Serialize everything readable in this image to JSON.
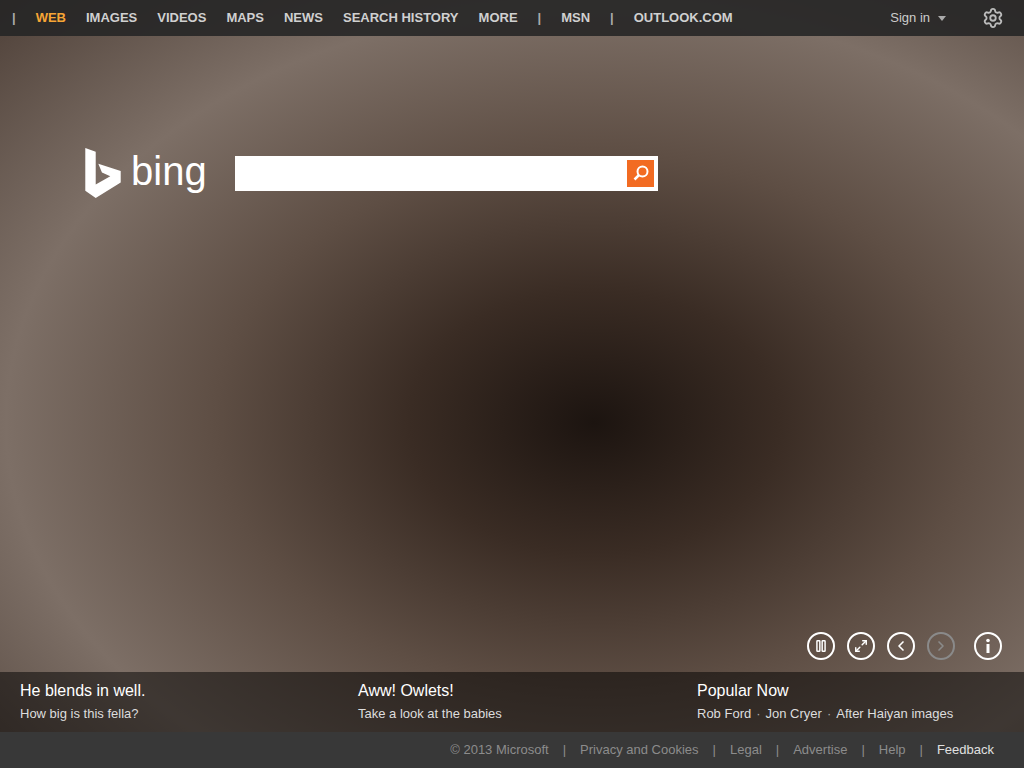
{
  "nav": {
    "items": [
      {
        "label": "|",
        "kind": "separator",
        "selected": false
      },
      {
        "label": "WEB",
        "kind": "link",
        "selected": true
      },
      {
        "label": "IMAGES",
        "kind": "link",
        "selected": false
      },
      {
        "label": "VIDEOS",
        "kind": "link",
        "selected": false
      },
      {
        "label": "MAPS",
        "kind": "link",
        "selected": false
      },
      {
        "label": "NEWS",
        "kind": "link",
        "selected": false
      },
      {
        "label": "SEARCH HISTORY",
        "kind": "link",
        "selected": false
      },
      {
        "label": "MORE",
        "kind": "link",
        "selected": false
      },
      {
        "label": "|",
        "kind": "separator",
        "selected": false
      },
      {
        "label": "MSN",
        "kind": "link",
        "selected": false
      },
      {
        "label": "|",
        "kind": "separator",
        "selected": false
      },
      {
        "label": "OUTLOOK.COM",
        "kind": "link",
        "selected": false
      }
    ],
    "sign_in": "Sign in"
  },
  "logo": {
    "text": "bing"
  },
  "search": {
    "placeholder": ""
  },
  "controls": [
    {
      "kind": "pause",
      "disabled": false
    },
    {
      "kind": "fullscreen",
      "disabled": false
    },
    {
      "kind": "previous",
      "disabled": false
    },
    {
      "kind": "next",
      "disabled": true
    },
    {
      "kind": "info",
      "disabled": false
    }
  ],
  "captions": [
    {
      "title": "He blends in well.",
      "subtitle": "How big is this fella?"
    },
    {
      "title": "Aww! Owlets!",
      "subtitle": "Take a look at the babies"
    }
  ],
  "popular_now": {
    "title": "Popular Now",
    "separator": "·",
    "items": [
      "Rob Ford",
      "Jon Cryer",
      "After Haiyan images"
    ]
  },
  "footer": {
    "copyright": "© 2013 Microsoft",
    "separator": "|",
    "links": [
      {
        "label": "Privacy and Cookies",
        "highlight": false
      },
      {
        "label": "Legal",
        "highlight": false
      },
      {
        "label": "Advertise",
        "highlight": false
      },
      {
        "label": "Help",
        "highlight": false
      },
      {
        "label": "Feedback",
        "highlight": true
      }
    ]
  }
}
